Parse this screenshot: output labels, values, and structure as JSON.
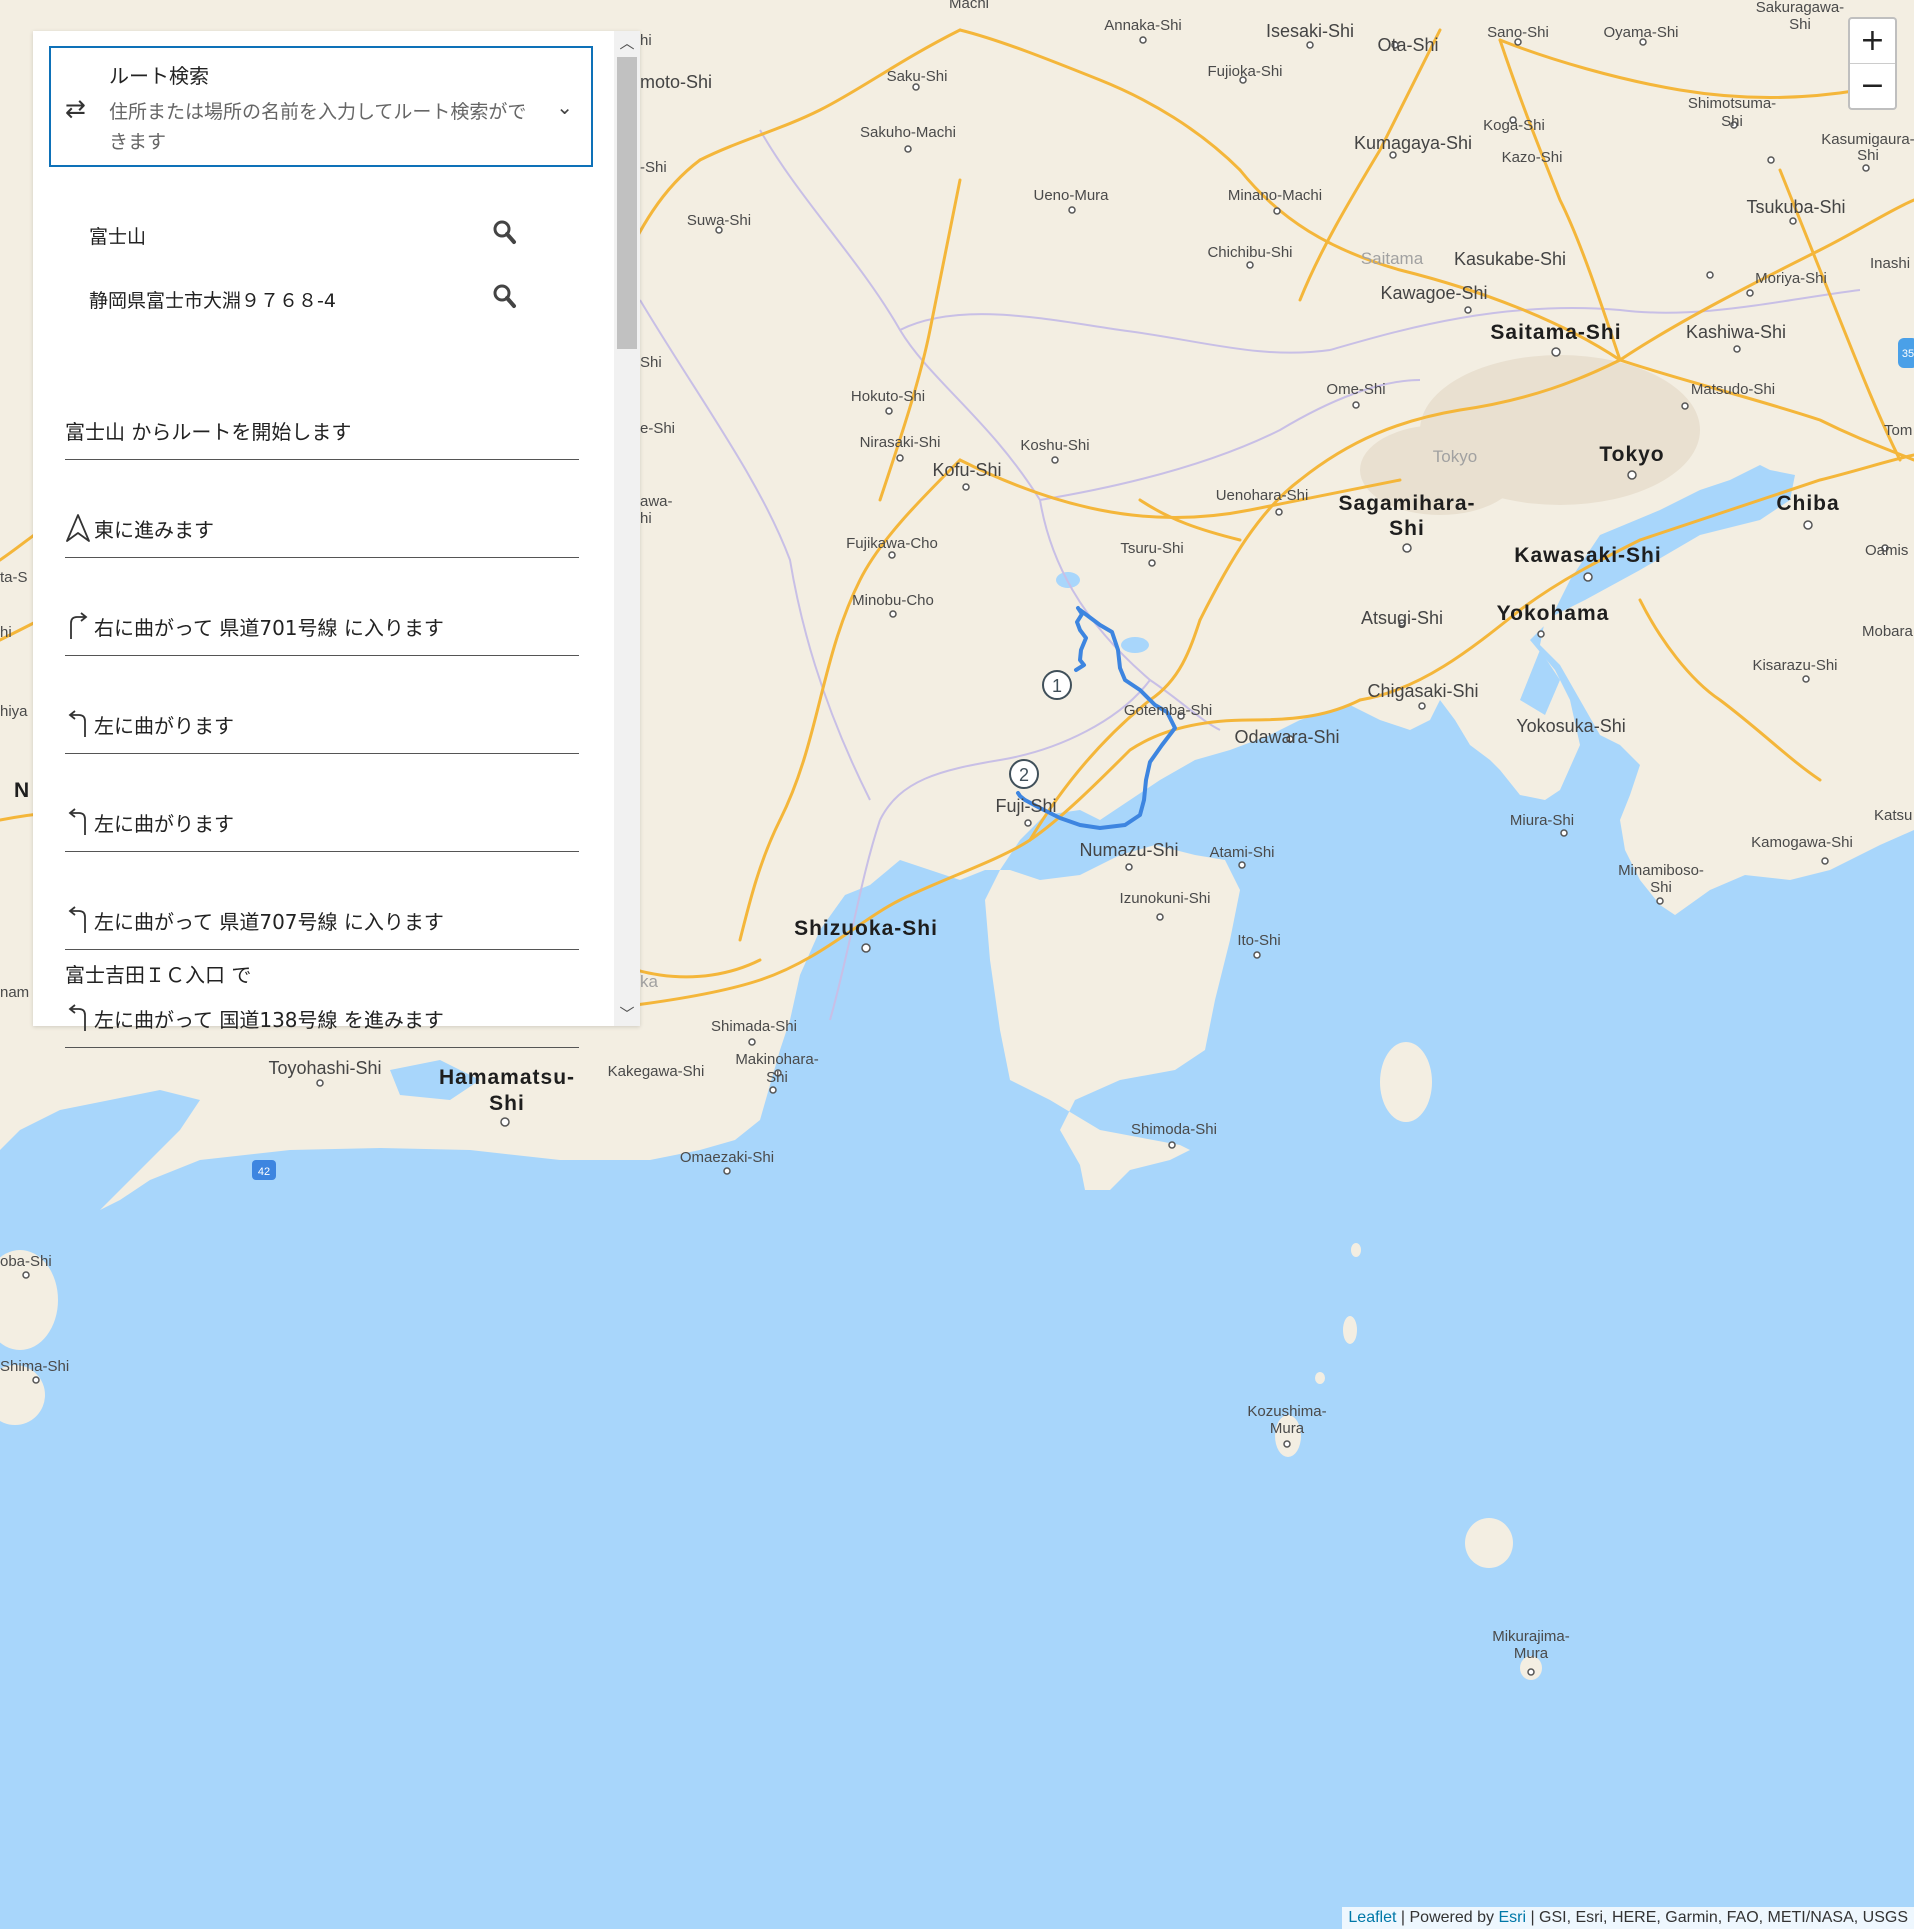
{
  "route_panel": {
    "title": "ルート検索",
    "placeholder": "住所または場所の名前を入力してルート検索ができます",
    "stops": [
      {
        "value": "富士山"
      },
      {
        "value": "静岡県富士市大淵９７６８-4"
      }
    ],
    "start_text": "富士山 からルートを開始します",
    "directions": [
      {
        "icon": "navigation-arrow-icon",
        "text": "東に進みます"
      },
      {
        "icon": "turn-right-icon",
        "text": "右に曲がって 県道701号線 に入ります"
      },
      {
        "icon": "turn-left-icon",
        "text": "左に曲がります"
      },
      {
        "icon": "turn-left-icon",
        "text": "左に曲がります"
      },
      {
        "icon": "turn-left-icon",
        "text": "左に曲がって 県道707号線 に入ります"
      },
      {
        "icon": "turn-left-icon",
        "prefix": "富士吉田ＩＣ入口 で",
        "text": "左に曲がって 国道138号線 を進みます"
      }
    ]
  },
  "zoom": {
    "in": "+",
    "out": "−"
  },
  "attribution": {
    "leaflet": "Leaflet",
    "powered": " | Powered by ",
    "esri": "Esri",
    "sources": " | GSI, Esri, HERE, Garmin, FAO, METI/NASA, USGS"
  },
  "map": {
    "marker_start": "1",
    "marker_end": "2",
    "highway_shield": "42",
    "route_color": "#3d85e0",
    "land_color": "#f3eee2",
    "water_color": "#a8d6fb",
    "labels": {
      "annaka": "Annaka-Shi",
      "isesaki": "Isesaki-Shi",
      "ota": "Ota-Shi",
      "sano": "Sano-Shi",
      "oyama": "Oyama-Shi",
      "saku": "Saku-Shi",
      "fujioka": "Fujioka-Shi",
      "sakuho": "Sakuho-Machi",
      "kumagaya": "Kumagaya-Shi",
      "koga": "Koga-Shi",
      "shimotsuma1": "Shimotsuma-",
      "shimotsuma2": "Shi",
      "kazo": "Kazo-Shi",
      "ueno": "Ueno-Mura",
      "minano": "Minano-Machi",
      "suwa": "Suwa-Shi",
      "chichibu": "Chichibu-Shi",
      "saitama_region": "Saitama",
      "kasukabe": "Kasukabe-Shi",
      "tsukuba": "Tsukuba-Shi",
      "moriya": "Moriya-Shi",
      "kawagoe": "Kawagoe-Shi",
      "saitama": "Saitama-Shi",
      "kashiwa": "Kashiwa-Shi",
      "hokuto": "Hokuto-Shi",
      "ome": "Ome-Shi",
      "matsudo": "Matsudo-Shi",
      "nirasaki": "Nirasaki-Shi",
      "koshu": "Koshu-Shi",
      "tokyo_region": "Tokyo",
      "tokyo": "Tokyo",
      "kofu": "Kofu-Shi",
      "uenohara": "Uenohara-Shi",
      "sagamihara1": "Sagamihara-",
      "sagamihara2": "Shi",
      "chiba": "Chiba",
      "fujikawa": "Fujikawa-Cho",
      "tsuru": "Tsuru-Shi",
      "kawasaki": "Kawasaki-Shi",
      "minobu": "Minobu-Cho",
      "atsugi": "Atsugi-Shi",
      "yokohama": "Yokohama",
      "kisarazu": "Kisarazu-Shi",
      "chigasaki": "Chigasaki-Shi",
      "gotemba": "Gotemba-Shi",
      "odawara": "Odawara-Shi",
      "yokosuka": "Yokosuka-Shi",
      "fuji": "Fuji-Shi",
      "numazu": "Numazu-Shi",
      "atami": "Atami-Shi",
      "miura": "Miura-Shi",
      "kamogawa": "Kamogawa-Shi",
      "minamiboso1": "Minamiboso-",
      "minamiboso2": "Shi",
      "izunokuni": "Izunokuni-Shi",
      "shizuoka": "Shizuoka-Shi",
      "ito": "Ito-Shi",
      "shimada": "Shimada-Shi",
      "makinohara1": "Makinohara-",
      "makinohara2": "Shi",
      "toyohashi": "Toyohashi-Shi",
      "kakegawa": "Kakegawa-Shi",
      "hamamatsu1": "Hamamatsu-",
      "hamamatsu2": "Shi",
      "shimoda": "Shimoda-Shi",
      "omaezaki": "Omaezaki-Shi",
      "kozushima1": "Kozushima-",
      "kozushima2": "Mura",
      "mikurajima1": "Mikurajima-",
      "mikurajima2": "Mura",
      "edge_machi": "Machi",
      "edge_sakuragawa1": "Sakuragawa-",
      "edge_sakuragawa2": "Shi",
      "edge_kasumigaura1": "Kasumigaura-",
      "edge_kasumigaura2": "Shi",
      "edge_inashi": "Inashi",
      "edge_tom": "Tom",
      "edge_oamis": "Oamis",
      "edge_mobara": "Mobara",
      "edge_katsu": "Katsu",
      "edge_hi1": "hi",
      "edge_moto": "moto-Shi",
      "edge_hi2": "-Shi",
      "edge_hi3": "Shi",
      "edge_eshi": "e-Shi",
      "edge_awa1": "awa-",
      "edge_awa2": "hi",
      "edge_ka": "ka",
      "edge_tashi": "ta-S",
      "edge_hi4": "hi",
      "edge_hiya": "hiya",
      "edge_n": "N",
      "edge_nam": "nam",
      "edge_oba": "oba-Shi",
      "edge_shima": "Shima-Shi",
      "edge_35": "35"
    }
  }
}
